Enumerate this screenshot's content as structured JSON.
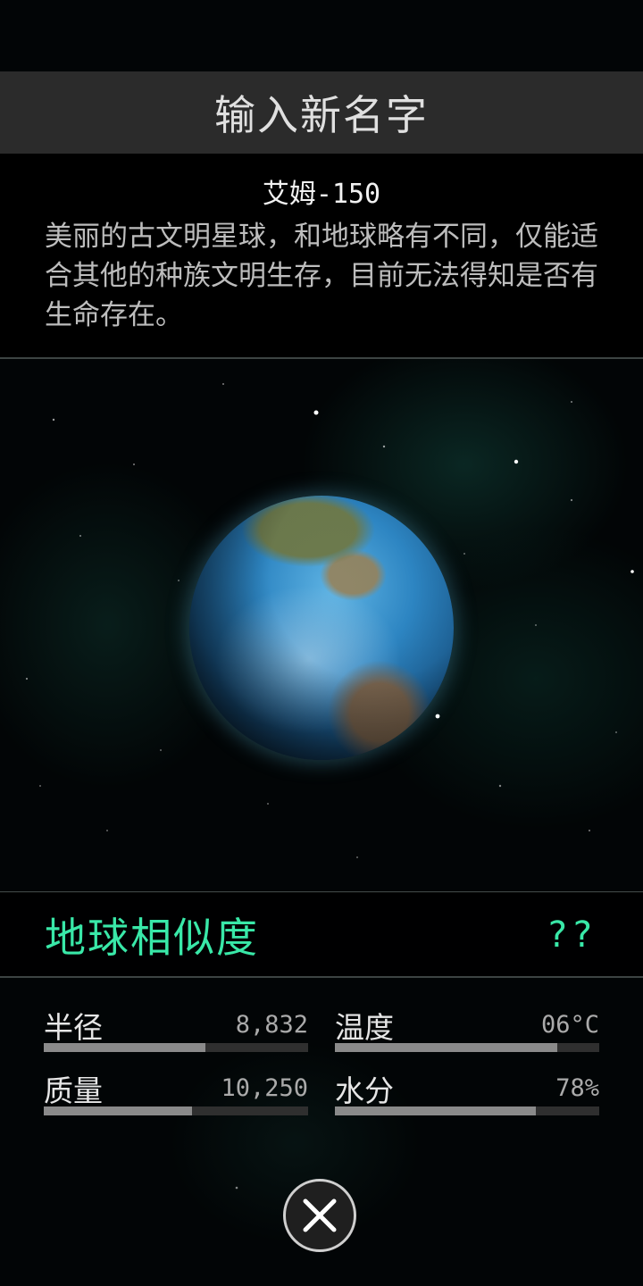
{
  "header": {
    "title": "输入新名字"
  },
  "planet": {
    "name": "艾姆-150",
    "description": "美丽的古文明星球，和地球略有不同，仅能适合其他的种族文明生存，目前无法得知是否有生命存在。"
  },
  "similarity": {
    "label": "地球相似度",
    "value": "??"
  },
  "stats": [
    {
      "label": "半径",
      "value": "8,832",
      "level": 0.61
    },
    {
      "label": "温度",
      "value": "06°C",
      "level": 0.84
    },
    {
      "label": "质量",
      "value": "10,250",
      "level": 0.56
    },
    {
      "label": "水分",
      "value": "78%",
      "level": 0.76
    }
  ],
  "colors": {
    "accent": "#39e8a8",
    "header_bg": "#2b2b2b",
    "bar_fill": "#8a8a8a"
  },
  "icons": {
    "close": "close-icon"
  }
}
